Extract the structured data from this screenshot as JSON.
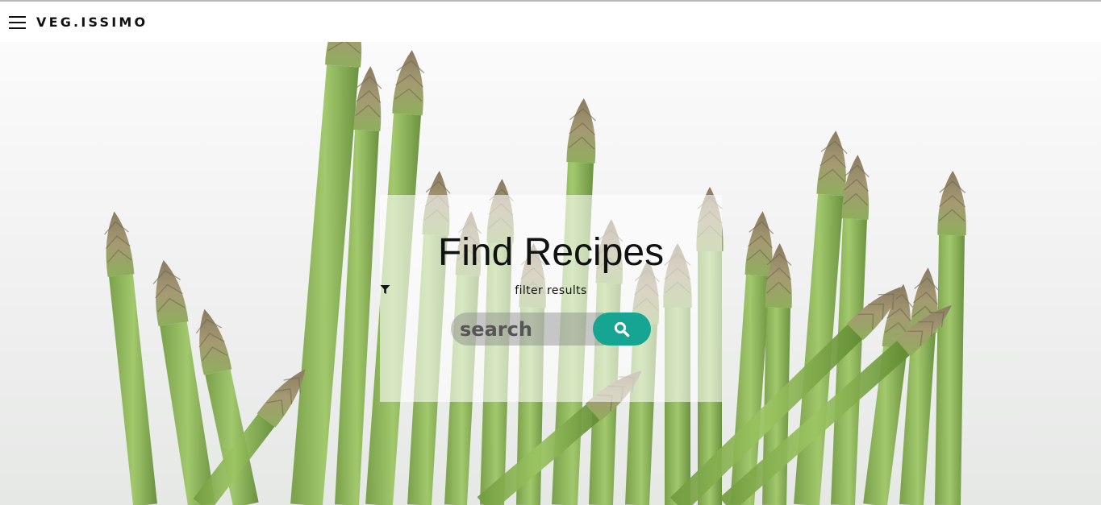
{
  "header": {
    "menu_icon": "hamburger-menu-icon",
    "brand": "VEG.ISSIMO"
  },
  "hero": {
    "background_image": "asparagus-bunch",
    "title": "Find Recipes",
    "filter_icon": "funnel-icon",
    "filter_label": "filter results",
    "search": {
      "placeholder": "search",
      "value": "",
      "button_icon": "search-icon"
    }
  },
  "colors": {
    "accent": "#17a593",
    "text": "#111111",
    "search_field_bg": "#a0a0a0"
  }
}
